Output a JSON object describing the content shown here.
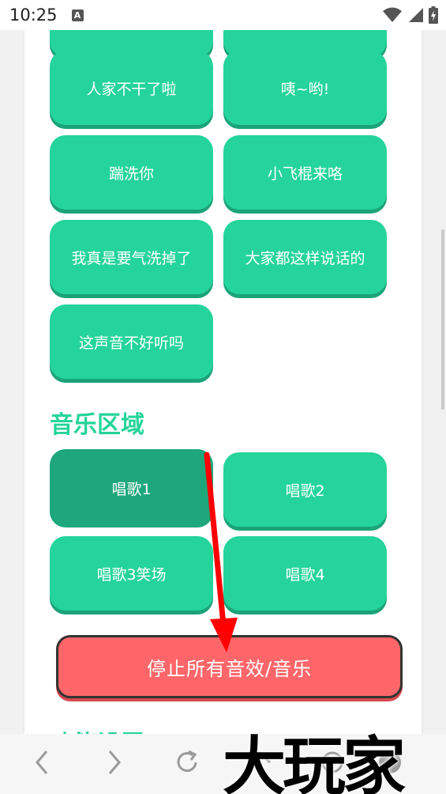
{
  "status_bar": {
    "time": "10:25",
    "notification_icon_letter": "A"
  },
  "sound_buttons": {
    "partial_left": "",
    "partial_right": "",
    "items": [
      {
        "label": "人家不干了啦"
      },
      {
        "label": "咦~哟!"
      },
      {
        "label": "踹洗你"
      },
      {
        "label": "小飞棍来咯"
      },
      {
        "label": "我真是要气洗掉了"
      },
      {
        "label": "大家都这样说话的"
      },
      {
        "label": "这声音不好听吗"
      }
    ]
  },
  "music_section": {
    "title": "音乐区域",
    "items": [
      {
        "label": "唱歌1",
        "pressed": true
      },
      {
        "label": "唱歌2",
        "pressed": false
      },
      {
        "label": "唱歌3笑场",
        "pressed": false
      },
      {
        "label": "唱歌4",
        "pressed": false
      }
    ]
  },
  "stop_button": {
    "label": "停止所有音效/音乐"
  },
  "next_section": {
    "title_partial": "功能设置"
  },
  "watermark": {
    "text": "大玩家"
  },
  "colors": {
    "accent": "#25d49a",
    "accent_pressed": "#1ea77a",
    "stop": "#ff6669",
    "arrow": "#ff0000"
  },
  "icons": {
    "wifi": "wifi-icon",
    "signal": "signal-icon",
    "battery": "battery-charging-icon",
    "back": "chevron-left-icon",
    "forward": "chevron-right-icon",
    "reload": "reload-icon",
    "home": "home-icon",
    "tabs": "tabs-icon",
    "menu": "menu-icon"
  }
}
